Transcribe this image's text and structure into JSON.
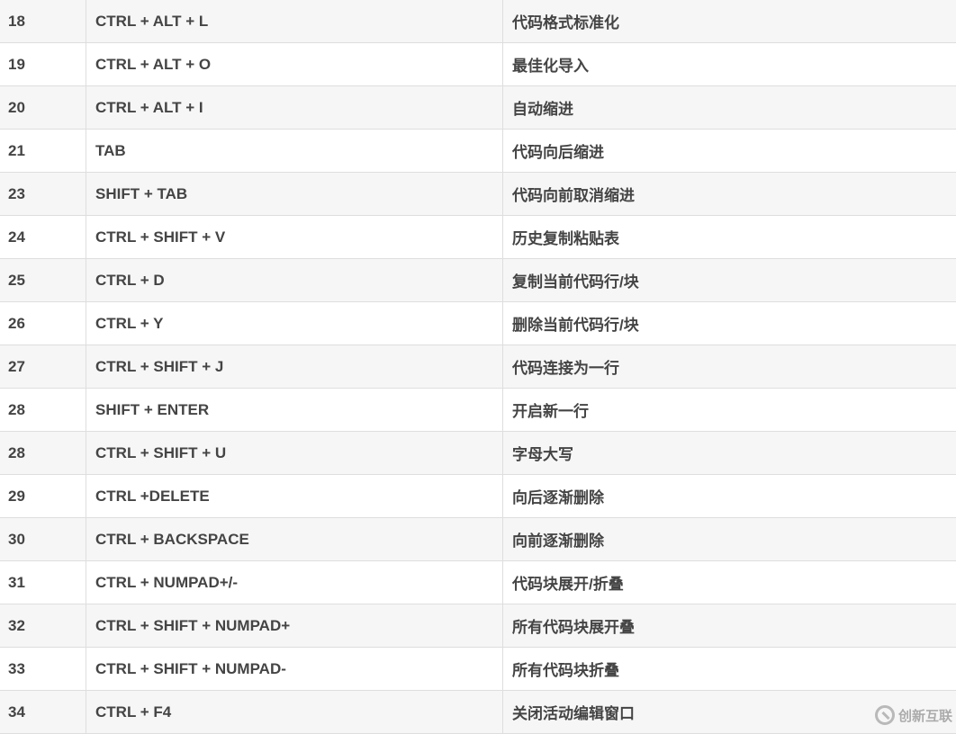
{
  "rows": [
    {
      "no": "18",
      "keys": "CTRL + ALT + L",
      "desc": "代码格式标准化"
    },
    {
      "no": "19",
      "keys": "CTRL + ALT + O",
      "desc": "最佳化导入"
    },
    {
      "no": "20",
      "keys": "CTRL + ALT + I",
      "desc": "自动缩进"
    },
    {
      "no": "21",
      "keys": "TAB",
      "desc": "代码向后缩进"
    },
    {
      "no": "23",
      "keys": "SHIFT + TAB",
      "desc": "代码向前取消缩进"
    },
    {
      "no": "24",
      "keys": "CTRL + SHIFT + V",
      "desc": "历史复制粘贴表"
    },
    {
      "no": "25",
      "keys": "CTRL + D",
      "desc": "复制当前代码行/块"
    },
    {
      "no": "26",
      "keys": "CTRL + Y",
      "desc": "删除当前代码行/块"
    },
    {
      "no": "27",
      "keys": "CTRL + SHIFT + J",
      "desc": "代码连接为一行"
    },
    {
      "no": "28",
      "keys": "SHIFT + ENTER",
      "desc": "开启新一行"
    },
    {
      "no": "28",
      "keys": "CTRL + SHIFT + U",
      "desc": "字母大写"
    },
    {
      "no": "29",
      "keys": "CTRL +DELETE",
      "desc": "向后逐渐删除"
    },
    {
      "no": "30",
      "keys": "CTRL + BACKSPACE",
      "desc": "向前逐渐删除"
    },
    {
      "no": "31",
      "keys": "CTRL + NUMPAD+/-",
      "desc": "代码块展开/折叠"
    },
    {
      "no": "32",
      "keys": "CTRL + SHIFT + NUMPAD+",
      "desc": "所有代码块展开叠"
    },
    {
      "no": "33",
      "keys": "CTRL + SHIFT + NUMPAD-",
      "desc": "所有代码块折叠"
    },
    {
      "no": "34",
      "keys": "CTRL + F4",
      "desc": "关闭活动编辑窗口"
    }
  ],
  "watermark": "创新互联"
}
